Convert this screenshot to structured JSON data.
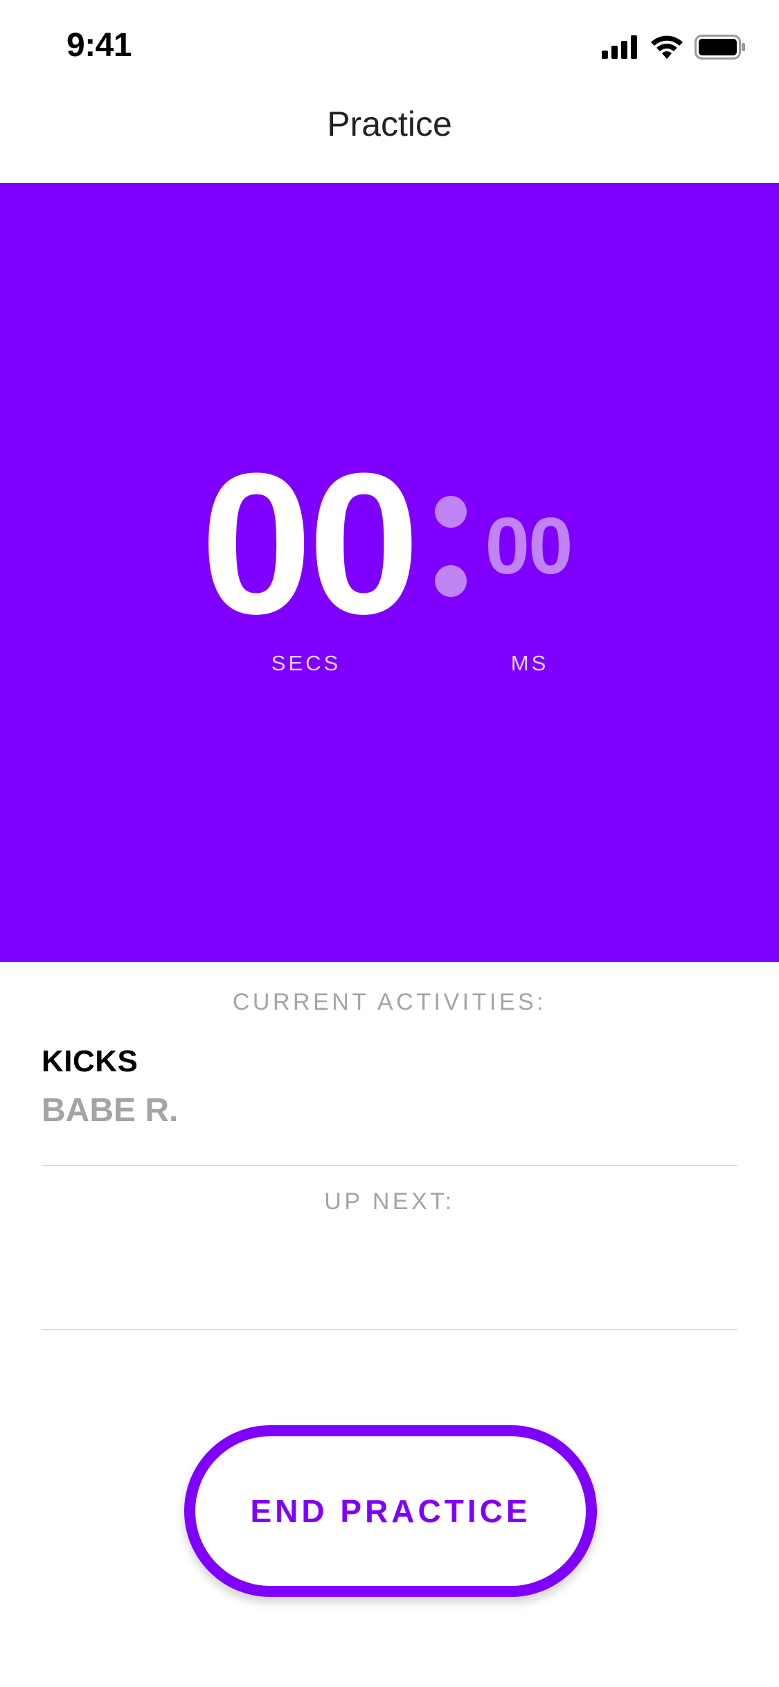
{
  "status_bar": {
    "time": "9:41",
    "icons": [
      "cellular-signal-icon",
      "wifi-icon",
      "battery-icon"
    ]
  },
  "nav": {
    "title": "Practice"
  },
  "timer": {
    "seconds": "00",
    "milliseconds": "00",
    "seconds_label": "SECS",
    "milliseconds_label": "MS",
    "background_color": "#7f00ff"
  },
  "activities": {
    "current_label": "CURRENT ACTIVITIES:",
    "current": {
      "name": "KICKS",
      "person": "BABE R."
    },
    "up_next_label": "UP NEXT:"
  },
  "actions": {
    "end_label": "END PRACTICE",
    "accent_color": "#7f00ff"
  }
}
